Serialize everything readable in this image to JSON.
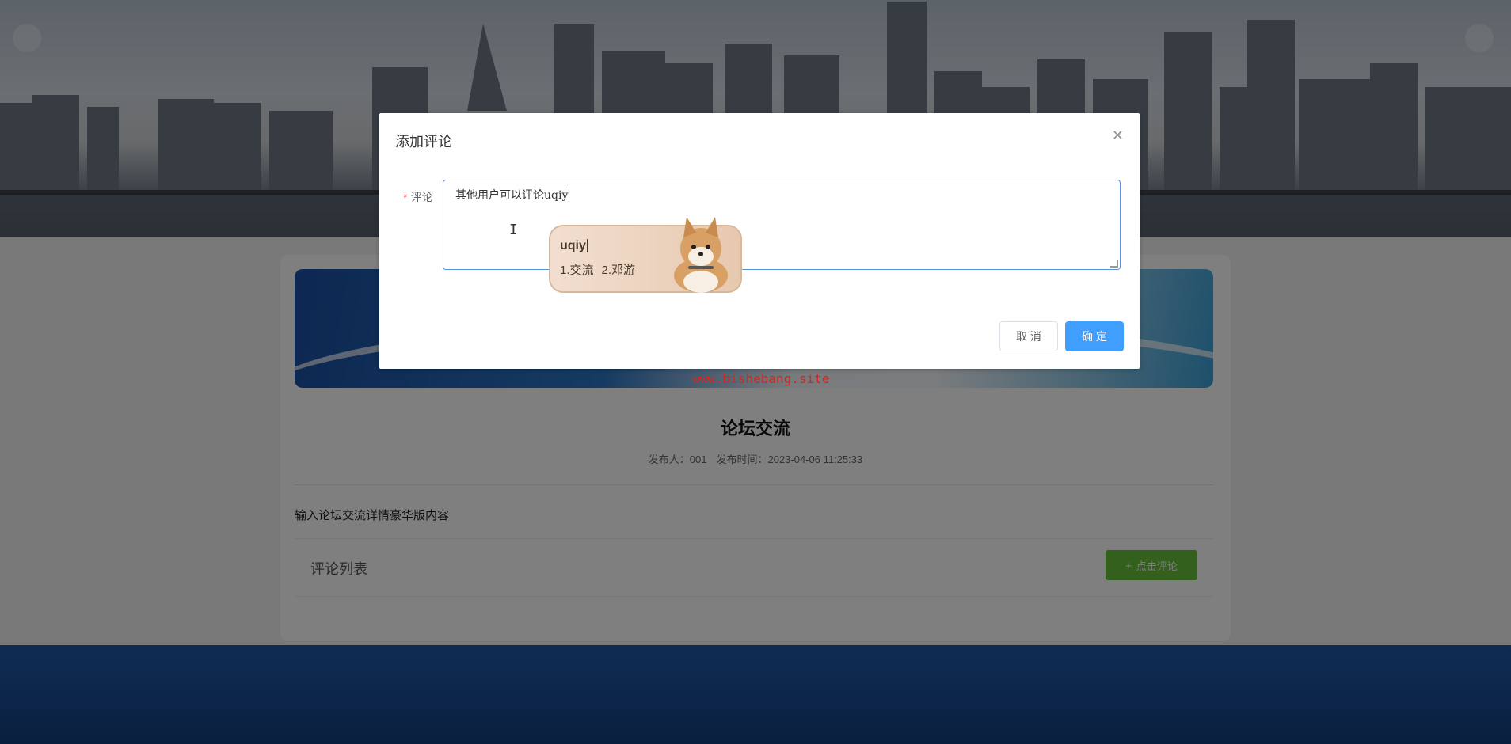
{
  "watermark": "www.bishebang.site",
  "page": {
    "title": "论坛交流",
    "meta_author": "发布人：001",
    "meta_time": "发布时间：2023-04-06 11:25:33",
    "content": "输入论坛交流详情豪华版内容",
    "comments_title": "评论列表",
    "comment_button_label": "点击评论",
    "comment_button_icon": "plus-icon"
  },
  "dialog": {
    "title": "添加评论",
    "close_icon": "close-icon",
    "field_label": "评论",
    "field_value": "其他用户可以评论uqiy",
    "cancel_label": "取 消",
    "ok_label": "确 定"
  },
  "ime": {
    "input": "uqiy",
    "candidate_1": "1.交流",
    "candidate_2": "2.邓游"
  },
  "colors": {
    "primary": "#409eff",
    "success": "#67c23a",
    "danger": "#f56c6c",
    "watermark": "#e3201b"
  }
}
